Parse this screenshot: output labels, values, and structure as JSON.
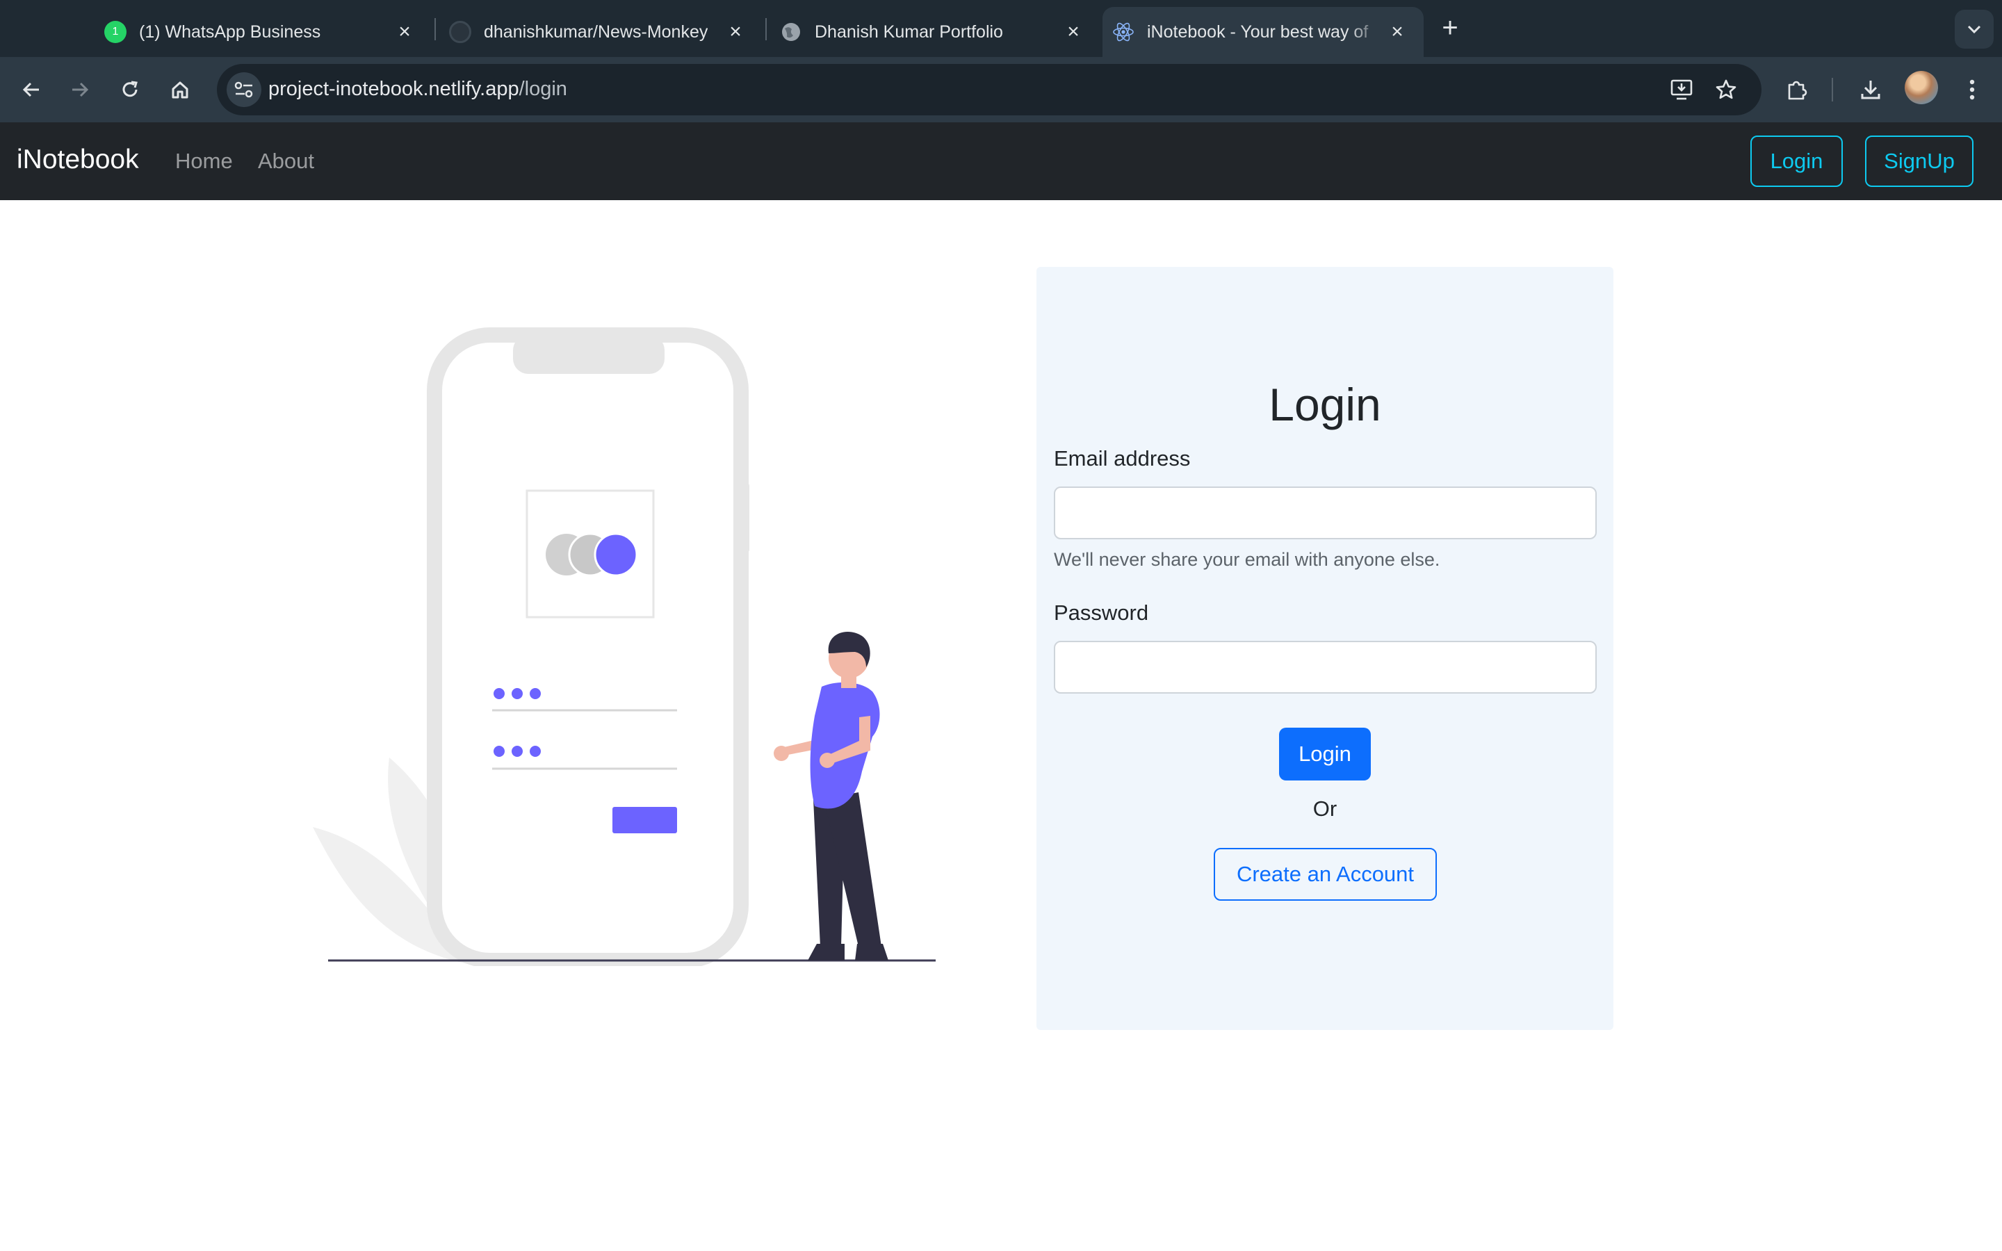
{
  "browser": {
    "tabs": [
      {
        "title": "(1) WhatsApp Business",
        "badge": "1",
        "favicon": "whatsapp-icon"
      },
      {
        "title": "dhanishkumar/News-Monkey",
        "favicon": "github-icon"
      },
      {
        "title": "Dhanish Kumar Portfolio",
        "favicon": "globe-icon"
      },
      {
        "title": "iNotebook - Your best way of",
        "favicon": "react-icon",
        "active": true
      }
    ],
    "url_host": "project-inotebook.netlify.app",
    "url_path": "/login"
  },
  "navbar": {
    "brand": "iNotebook",
    "links": [
      "Home",
      "About"
    ],
    "login_button": "Login",
    "signup_button": "SignUp"
  },
  "form": {
    "title": "Login",
    "email_label": "Email address",
    "email_value": "",
    "email_help": "We'll never share your email with anyone else.",
    "password_label": "Password",
    "password_value": "",
    "submit_button": "Login",
    "separator": "Or",
    "create_account_button": "Create an Account"
  },
  "colors": {
    "navbar_bg": "#212529",
    "card_bg": "#f0f6fc",
    "primary": "#0d6efd",
    "info": "#0dcaf0",
    "illustration_accent": "#6c63ff"
  }
}
